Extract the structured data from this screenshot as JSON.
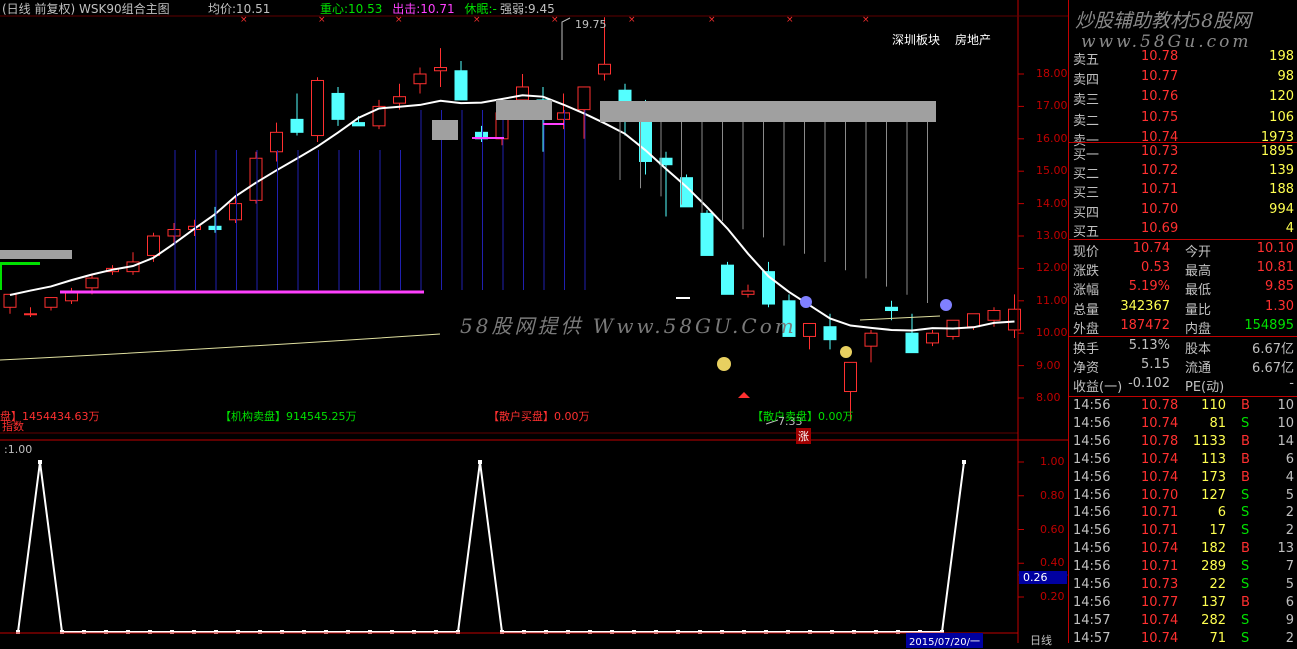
{
  "header": {
    "title": "(日线 前复权) WSK90组合主图",
    "avg_label": "均价:",
    "avg_value": "10.51",
    "center_label": "重心:",
    "center_value": "10.53",
    "out_label": "出击:",
    "out_value": "10.71",
    "rest_label": "休眠:",
    "rest_value": "-",
    "strength_label": "强弱:",
    "strength_value": "9.45"
  },
  "sector_labels": [
    "深圳板块",
    "房地产"
  ],
  "price_axis": [
    "18.00",
    "17.00",
    "16.00",
    "15.00",
    "14.00",
    "13.00",
    "12.00",
    "11.00",
    "10.00",
    "9.00",
    "8.00"
  ],
  "peak_label": "19.75",
  "low_label": "7.33",
  "rise_badge": "涨",
  "watermark_center": "58股网提供 Www.58GU.Com",
  "watermark_top": "炒股辅助教材58股网",
  "watermark_url": "www.58Gu.com",
  "money_flow": {
    "left": "盘】1454434.63万",
    "institution": "【机构卖盘】914545.25万",
    "retail": "【散户买盘】0.00万",
    "retail_sell": "【散户卖盘】0.00万",
    "left2": "指数"
  },
  "lower_panel": {
    "label": ":1.00",
    "axis": [
      "1.00",
      "0.80",
      "0.60",
      "0.40",
      "0.20"
    ],
    "current": "0.26",
    "date": "2015/07/20/一",
    "bottom_right": "日线"
  },
  "order_book": {
    "asks": [
      {
        "label": "卖五",
        "price": "10.78",
        "vol": "198"
      },
      {
        "label": "卖四",
        "price": "10.77",
        "vol": "98"
      },
      {
        "label": "卖三",
        "price": "10.76",
        "vol": "120"
      },
      {
        "label": "卖二",
        "price": "10.75",
        "vol": "106"
      },
      {
        "label": "卖一",
        "price": "10.74",
        "vol": "1973"
      }
    ],
    "bids": [
      {
        "label": "买一",
        "price": "10.73",
        "vol": "1895"
      },
      {
        "label": "买二",
        "price": "10.72",
        "vol": "139"
      },
      {
        "label": "买三",
        "price": "10.71",
        "vol": "188"
      },
      {
        "label": "买四",
        "price": "10.70",
        "vol": "994"
      },
      {
        "label": "买五",
        "price": "10.69",
        "vol": "4"
      }
    ]
  },
  "quote": [
    {
      "l1": "现价",
      "v1": "10.74",
      "l2": "今开",
      "v2": "10.10",
      "c1": "#ff3030",
      "c2": "#ff3030"
    },
    {
      "l1": "涨跌",
      "v1": "0.53",
      "l2": "最高",
      "v2": "10.81",
      "c1": "#ff3030",
      "c2": "#ff3030"
    },
    {
      "l1": "涨幅",
      "v1": "5.19%",
      "l2": "最低",
      "v2": "9.85",
      "c1": "#ff3030",
      "c2": "#ff3030"
    },
    {
      "l1": "总量",
      "v1": "342367",
      "l2": "量比",
      "v2": "1.30",
      "c1": "#ffff50",
      "c2": "#ff3030"
    },
    {
      "l1": "外盘",
      "v1": "187472",
      "l2": "内盘",
      "v2": "154895",
      "c1": "#ff3030",
      "c2": "#00e000"
    }
  ],
  "fundamentals": [
    {
      "l1": "换手",
      "v1": "5.13%",
      "l2": "股本",
      "v2": "6.67亿"
    },
    {
      "l1": "净资",
      "v1": "5.15",
      "l2": "流通",
      "v2": "6.67亿"
    },
    {
      "l1": "收益(一)",
      "v1": "-0.102",
      "l2": "PE(动)",
      "v2": "-"
    }
  ],
  "ticks": [
    {
      "time": "14:56",
      "price": "10.78",
      "vol": "110",
      "side": "B",
      "n": "10"
    },
    {
      "time": "14:56",
      "price": "10.74",
      "vol": "81",
      "side": "S",
      "n": "10"
    },
    {
      "time": "14:56",
      "price": "10.78",
      "vol": "1133",
      "side": "B",
      "n": "14"
    },
    {
      "time": "14:56",
      "price": "10.74",
      "vol": "113",
      "side": "B",
      "n": "6"
    },
    {
      "time": "14:56",
      "price": "10.74",
      "vol": "173",
      "side": "B",
      "n": "4"
    },
    {
      "time": "14:56",
      "price": "10.70",
      "vol": "127",
      "side": "S",
      "n": "5"
    },
    {
      "time": "14:56",
      "price": "10.71",
      "vol": "6",
      "side": "S",
      "n": "2"
    },
    {
      "time": "14:56",
      "price": "10.71",
      "vol": "17",
      "side": "S",
      "n": "2"
    },
    {
      "time": "14:56",
      "price": "10.74",
      "vol": "182",
      "side": "B",
      "n": "13"
    },
    {
      "time": "14:56",
      "price": "10.71",
      "vol": "289",
      "side": "S",
      "n": "7"
    },
    {
      "time": "14:56",
      "price": "10.73",
      "vol": "22",
      "side": "S",
      "n": "5"
    },
    {
      "time": "14:56",
      "price": "10.77",
      "vol": "137",
      "side": "B",
      "n": "6"
    },
    {
      "time": "14:57",
      "price": "10.74",
      "vol": "282",
      "side": "S",
      "n": "9"
    },
    {
      "time": "14:57",
      "price": "10.74",
      "vol": "71",
      "side": "S",
      "n": "2"
    }
  ],
  "colors": {
    "up": "#ff3030",
    "down": "#54ffff",
    "grid": "#c00000",
    "gold": "#ffff50"
  }
}
